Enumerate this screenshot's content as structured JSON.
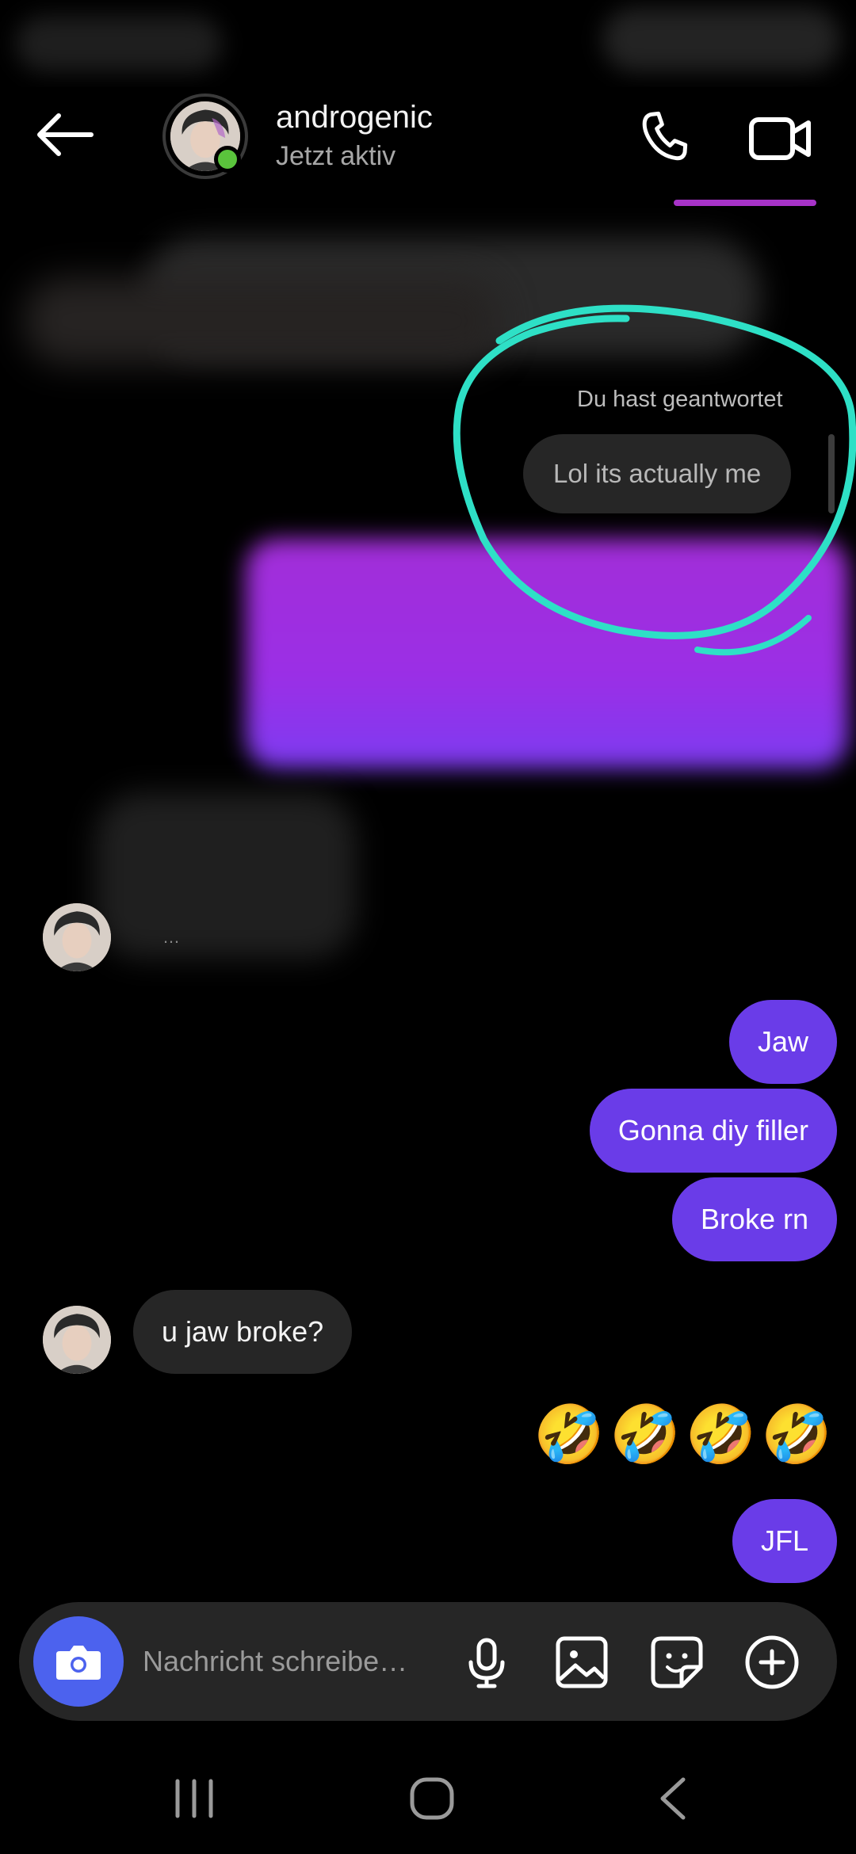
{
  "header": {
    "name": "androgenic",
    "status": "Jetzt aktiv",
    "back_icon": "back-arrow-icon",
    "call_icon": "phone-icon",
    "video_icon": "video-camera-icon"
  },
  "reply": {
    "label": "Du hast geantwortet",
    "text": "Lol its actually me"
  },
  "messages": [
    {
      "side": "in",
      "text": "…",
      "blurred": true
    },
    {
      "side": "out",
      "text": "Jaw"
    },
    {
      "side": "out",
      "text": "Gonna diy filler"
    },
    {
      "side": "out",
      "text": "Broke rn"
    },
    {
      "side": "in",
      "text": "u jaw broke?"
    },
    {
      "side": "out",
      "text": "🤣🤣🤣🤣",
      "emoji": true
    },
    {
      "side": "out",
      "text": "JFL"
    }
  ],
  "composer": {
    "placeholder": "Nachricht schreibe…",
    "icons": [
      "camera-icon",
      "microphone-icon",
      "gallery-icon",
      "sticker-icon",
      "plus-circle-icon"
    ]
  },
  "nav": {
    "icons": [
      "recent-apps-icon",
      "home-icon",
      "back-chevron-icon"
    ]
  },
  "colors": {
    "outgoing_bubble": "#6a3ce8",
    "incoming_bubble": "#262626",
    "camera_button": "#4c62ee",
    "online": "#5ac43c",
    "annotation_circle": "#2ee0c6"
  }
}
